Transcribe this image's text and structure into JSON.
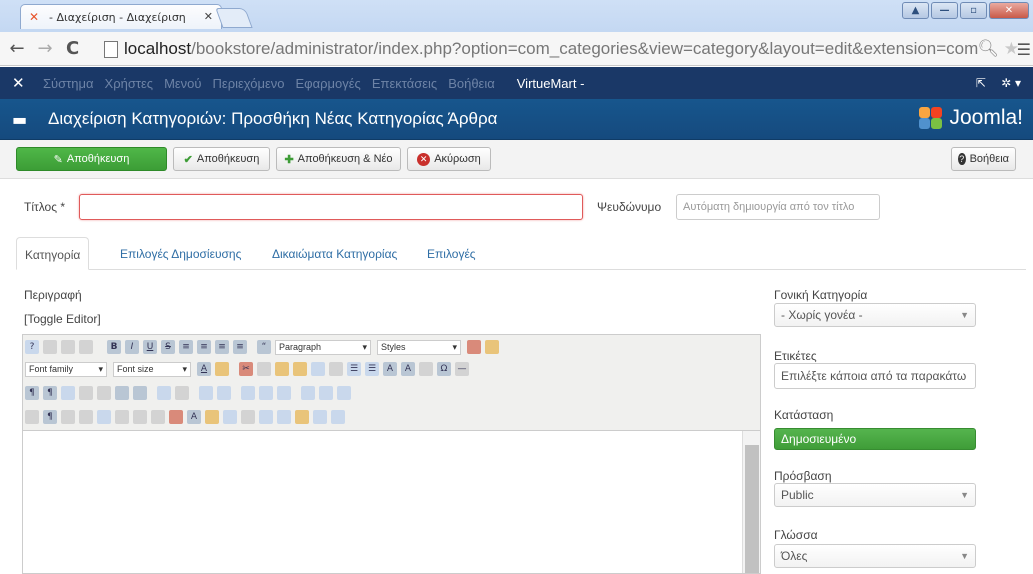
{
  "browser": {
    "tab_title": "- Διαχείριση - Διαχείριση",
    "url_host": "localhost",
    "url_path": "/bookstore/administrator/index.php?option=com_categories&view=category&layout=edit&extension=com"
  },
  "admin_menu": {
    "items": [
      "Σύστημα",
      "Χρήστες",
      "Μενού",
      "Περιεχόμενο",
      "Εφαρμογές",
      "Επεκτάσεις",
      "Βοήθεια"
    ],
    "virtuemart": "VirtueMart -"
  },
  "page": {
    "title": "Διαχείριση Κατηγοριών: Προσθήκη Νέας Κατηγορίας Άρθρα",
    "brand": "Joomla!"
  },
  "toolbar": {
    "save": "Αποθήκευση",
    "save_close": "Αποθήκευση",
    "save_new": "Αποθήκευση & Νέο",
    "cancel": "Ακύρωση",
    "help": "Βοήθεια"
  },
  "form": {
    "title_label": "Τίτλος *",
    "title_value": "",
    "alias_label": "Ψευδώνυμο",
    "alias_placeholder": "Αυτόματη δημιουργία από τον τίτλο",
    "tabs": [
      "Κατηγορία",
      "Επιλογές Δημοσίευσης",
      "Δικαιώματα Κατηγορίας",
      "Επιλογές"
    ],
    "description_label": "Περιγραφή",
    "toggle_editor": "[Toggle Editor]"
  },
  "editor": {
    "paragraph": "Paragraph",
    "styles": "Styles",
    "font_family": "Font family",
    "font_size": "Font size"
  },
  "sidebar": {
    "parent_label": "Γονική Κατηγορία",
    "parent_value": "- Χωρίς γονέα -",
    "tags_label": "Ετικέτες",
    "tags_placeholder": "Επιλέξτε κάποια από τα παρακάτω",
    "status_label": "Κατάσταση",
    "status_value": "Δημοσιευμένο",
    "access_label": "Πρόσβαση",
    "access_value": "Public",
    "language_label": "Γλώσσα",
    "language_value": "Όλες"
  },
  "colors": {
    "nav_bg": "#1a3867",
    "title_bg": "#17568d",
    "green": "#46a940",
    "error_border": "#e05a5a"
  }
}
